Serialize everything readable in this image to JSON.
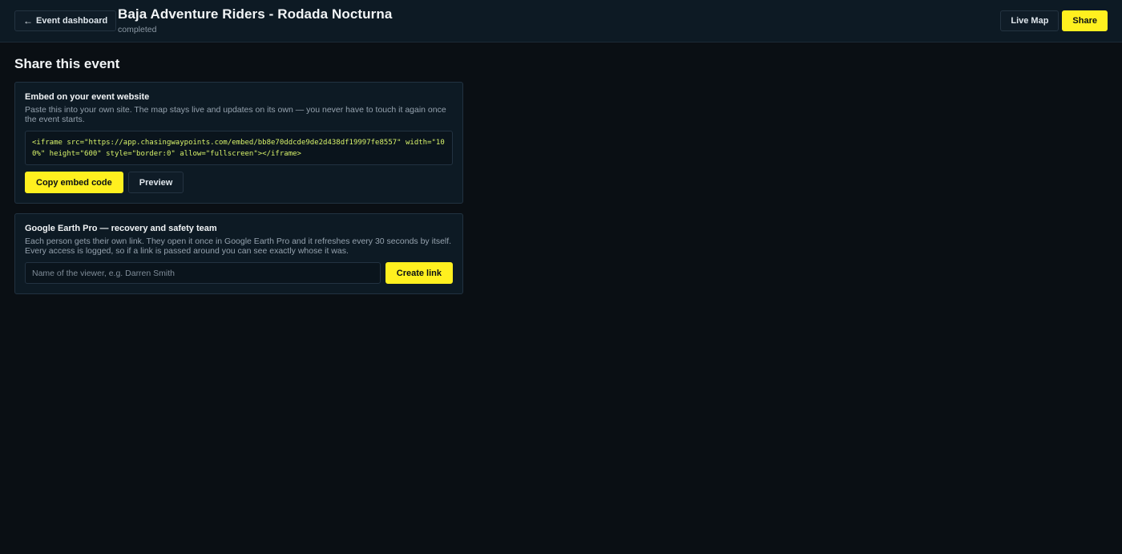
{
  "header": {
    "back_label": "Event dashboard",
    "back_icon": "←",
    "title": "Baja Adventure Riders - Rodada Nocturna",
    "status": "completed",
    "live_map_label": "Live Map",
    "share_label": "Share"
  },
  "page": {
    "section_title": "Share this event"
  },
  "embed": {
    "title": "Embed on your event website",
    "description": "Paste this into your own site. The map stays live and updates on its own — you never have to touch it again once the event starts.",
    "code": "<iframe src=\"https://app.chasingwaypoints.com/embed/bb8e70ddcde9de2d438df19997fe8557\" width=\"100%\" height=\"600\" style=\"border:0\" allow=\"fullscreen\"></iframe>",
    "copy_label": "Copy embed code",
    "preview_label": "Preview"
  },
  "earth": {
    "title": "Google Earth Pro — recovery and safety team",
    "description": "Each person gets their own link. They open it once in Google Earth Pro and it refreshes every 30 seconds by itself. Every access is logged, so if a link is passed around you can see exactly whose it was.",
    "input_placeholder": "Name of the viewer, e.g. Darren Smith",
    "input_value": "",
    "create_label": "Create link"
  },
  "colors": {
    "accent": "#fff01f",
    "background": "#0a0f14",
    "panel": "#0d1a24",
    "code_text": "#d7f26a"
  }
}
